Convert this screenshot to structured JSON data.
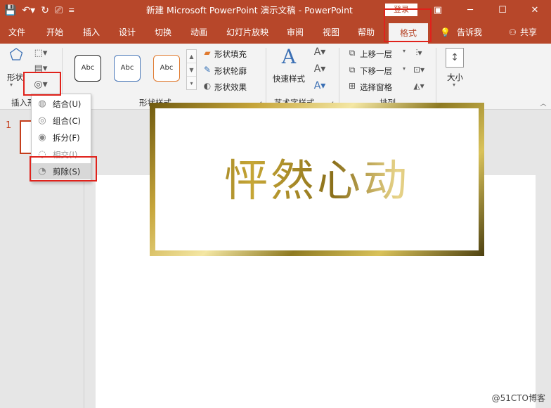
{
  "titlebar": {
    "title": "新建 Microsoft PowerPoint 演示文稿  -  PowerPoint",
    "login_label": "登录"
  },
  "tabs": [
    "文件",
    "开始",
    "插入",
    "设计",
    "切换",
    "动画",
    "幻灯片放映",
    "审阅",
    "视图",
    "帮助",
    "格式"
  ],
  "active_tab": "格式",
  "tell_me": "告诉我",
  "share": "共享",
  "ribbon": {
    "insert_shapes": {
      "shapes_label": "形状",
      "group_label": "插入形"
    },
    "shape_styles": {
      "abc_labels": [
        "Abc",
        "Abc",
        "Abc"
      ],
      "fill": "形状填充",
      "outline": "形状轮廓",
      "effects": "形状效果",
      "group_label": "形状样式"
    },
    "wordart": {
      "quick_styles": "快速样式",
      "group_label": "艺术字样式"
    },
    "arrange": {
      "bring_forward": "上移一层",
      "send_backward": "下移一层",
      "selection_pane": "选择窗格",
      "group_label": "排列"
    },
    "size": {
      "label": "大小"
    }
  },
  "merge_menu": {
    "items": [
      {
        "label": "结合(U)",
        "disabled": false
      },
      {
        "label": "组合(C)",
        "disabled": false
      },
      {
        "label": "拆分(F)",
        "disabled": false
      },
      {
        "label": "相交(I)",
        "disabled": true
      },
      {
        "label": "剪除(S)",
        "disabled": false
      }
    ],
    "highlighted": "剪除(S)"
  },
  "slides": {
    "current_number": "1"
  },
  "slide": {
    "headline": "怦然心动"
  },
  "watermark": "@51CTO博客",
  "colors": {
    "accent": "#b7472a",
    "highlight": "#e0221b"
  }
}
